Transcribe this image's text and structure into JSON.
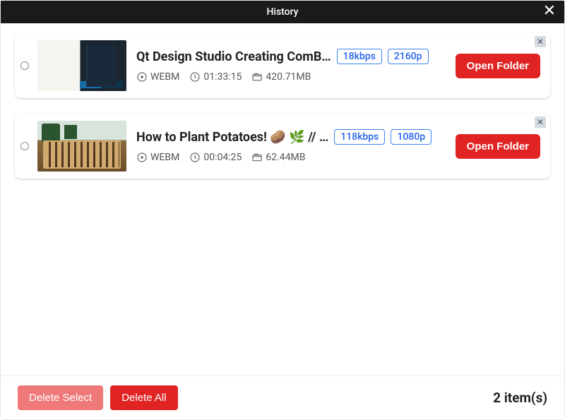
{
  "header": {
    "title": "History"
  },
  "items": [
    {
      "title": "Qt Design Studio Creating ComB…",
      "bitrate": "18kbps",
      "resolution": "2160p",
      "format": "WEBM",
      "duration": "01:33:15",
      "size": "420.71MB",
      "action": "Open Folder",
      "thumb_class": "thumb-dark"
    },
    {
      "title": "How to Plant Potatoes! 🥔 🌿 // …",
      "bitrate": "118kbps",
      "resolution": "1080p",
      "format": "WEBM",
      "duration": "00:04:25",
      "size": "62.44MB",
      "action": "Open Folder",
      "thumb_class": "thumb-garden"
    }
  ],
  "footer": {
    "delete_select": "Delete Select",
    "delete_all": "Delete All",
    "count": "2 item(s)"
  }
}
